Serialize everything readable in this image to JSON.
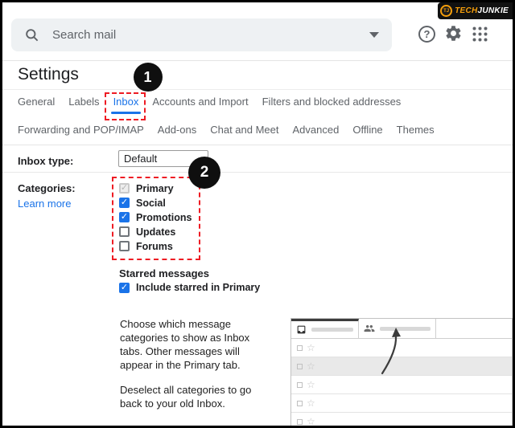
{
  "watermark": {
    "brand": "TechJunkie",
    "monogram": "TJ",
    "tech": "TECH",
    "junkie": "JUNKIE"
  },
  "topbar": {
    "search_placeholder": "Search mail"
  },
  "page_title": "Settings",
  "tabs": {
    "active_tab": "Inbox",
    "row1": [
      "General",
      "Labels",
      "Inbox",
      "Accounts and Import",
      "Filters and blocked addresses"
    ],
    "row2": [
      "Forwarding and POP/IMAP",
      "Add-ons",
      "Chat and Meet",
      "Advanced",
      "Offline",
      "Themes"
    ]
  },
  "annotations": {
    "step1": "1",
    "step2": "2"
  },
  "settings": {
    "inbox_type": {
      "label": "Inbox type:",
      "value": "Default"
    },
    "categories": {
      "label": "Categories:",
      "link": "Learn more",
      "options": [
        {
          "label": "Primary",
          "state": "checked-disabled"
        },
        {
          "label": "Social",
          "state": "checked"
        },
        {
          "label": "Promotions",
          "state": "checked"
        },
        {
          "label": "Updates",
          "state": "unchecked"
        },
        {
          "label": "Forums",
          "state": "unchecked"
        }
      ]
    },
    "starred": {
      "heading": "Starred messages",
      "option": "Include starred in Primary",
      "state": "checked"
    },
    "description": [
      "Choose which message categories to show as Inbox tabs. Other messages will appear in the Primary tab.",
      "Deselect all categories to go back to your old Inbox."
    ]
  },
  "icons": {
    "check": "✓",
    "star": "☆",
    "question": "?"
  },
  "colors": {
    "accent_blue": "#1a73e8",
    "annotation_red": "#ee1c24",
    "badge_black": "#111111",
    "row_highlight": "#e9e9e9"
  }
}
